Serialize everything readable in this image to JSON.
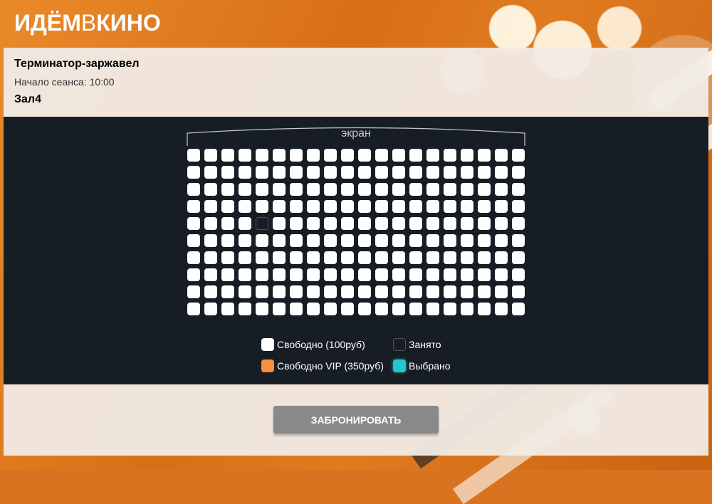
{
  "logo": {
    "part1": "ИДЁМ",
    "part2": "В",
    "part3": "КИНО"
  },
  "film": {
    "title": "Терминатор-заржавел",
    "session_start": "Начало сеанса: 10:00",
    "hall": "Зал4"
  },
  "hall_scheme": {
    "screen_label": "экран",
    "rows": 10,
    "seats_per_row": 20,
    "taken_seats": [
      {
        "row": 5,
        "seat": 5
      }
    ]
  },
  "legend": {
    "free": "Свободно (100руб)",
    "taken": "Занято",
    "vip": "Свободно VIP (350руб)",
    "selected": "Выбрано"
  },
  "colors": {
    "standart": "#ffffff",
    "vip": "#f99040",
    "taken": "#171d24",
    "selected": "#25c4ce",
    "hall_background": "#171d24",
    "button": "#898989"
  },
  "actions": {
    "book_label": "ЗАБРОНИРОВАТЬ"
  }
}
